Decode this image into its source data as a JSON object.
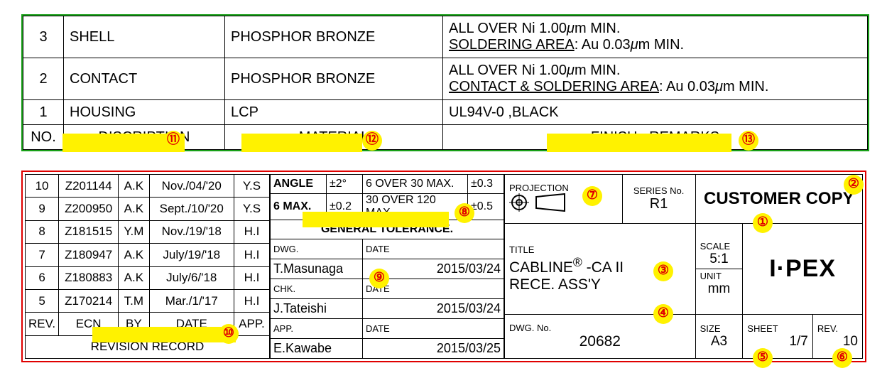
{
  "parts": {
    "headers": {
      "no": "NO.",
      "desc": "DISCRIPTION",
      "mat": "MATERIAL",
      "finish": "FINISH , REMARKS"
    },
    "rows": [
      {
        "no": "3",
        "desc": "SHELL",
        "mat": "PHOSPHOR BRONZE",
        "finish_l1a": "ALL OVER Ni 1.00",
        "finish_l1b": "μ",
        "finish_l1c": "m MIN.",
        "finish_l2a": "SOLDERING AREA",
        "finish_l2b": " : Au 0.03",
        "finish_l2c": "μ",
        "finish_l2d": "m MIN."
      },
      {
        "no": "2",
        "desc": "CONTACT",
        "mat": "PHOSPHOR BRONZE",
        "finish_l1a": "ALL OVER Ni 1.00",
        "finish_l1b": "μ",
        "finish_l1c": "m MIN.",
        "finish_l2a": "CONTACT & SOLDERING AREA",
        "finish_l2b": " : Au 0.03",
        "finish_l2c": "μ",
        "finish_l2d": "m MIN."
      },
      {
        "no": "1",
        "desc": "HOUSING",
        "mat": "LCP",
        "finish_plain": "UL94V-0 ,BLACK"
      }
    ]
  },
  "revisions": {
    "headers": {
      "rev": "REV.",
      "ecn": "ECN",
      "by": "BY",
      "date": "DATE",
      "app": "APP."
    },
    "title": "REVISION RECORD",
    "rows": [
      {
        "rev": "10",
        "ecn": "Z201144",
        "by": "A.K",
        "date": "Nov./04/'20",
        "app": "Y.S"
      },
      {
        "rev": "9",
        "ecn": "Z200950",
        "by": "A.K",
        "date": "Sept./10/'20",
        "app": "Y.S"
      },
      {
        "rev": "8",
        "ecn": "Z181515",
        "by": "Y.M",
        "date": "Nov./19/'18",
        "app": "H.I"
      },
      {
        "rev": "7",
        "ecn": "Z180947",
        "by": "A.K",
        "date": "July/19/'18",
        "app": "H.I"
      },
      {
        "rev": "6",
        "ecn": "Z180883",
        "by": "A.K",
        "date": "July/6/'18",
        "app": "H.I"
      },
      {
        "rev": "5",
        "ecn": "Z170214",
        "by": "T.M",
        "date": "Mar./1/'17",
        "app": "H.I"
      }
    ]
  },
  "tolerance": {
    "r1c1": "ANGLE",
    "r1c2": "±2°",
    "r1c3": "6 OVER 30 MAX.",
    "r1c4": "±0.3",
    "r2c1": "6 MAX.",
    "r2c2": "±0.2",
    "r2c3": "30 OVER 120 MAX.",
    "r2c4": "±0.5",
    "title": "GENERAL TOLERANCE."
  },
  "signatures": {
    "dwg_lbl": "DWG.",
    "dwg_name": "T.Masunaga",
    "dwg_date_lbl": "DATE",
    "dwg_date": "2015/03/24",
    "chk_lbl": "CHK.",
    "chk_name": "J.Tateishi",
    "chk_date_lbl": "DATE",
    "chk_date": "2015/03/24",
    "app_lbl": "APP.",
    "app_name": "E.Kawabe",
    "app_date_lbl": "DATE",
    "app_date": "2015/03/25"
  },
  "titleblock": {
    "projection_lbl": "PROJECTION",
    "series_lbl": "SERIES No.",
    "series": "R1",
    "copy": "CUSTOMER COPY",
    "title_lbl": "TITLE",
    "title_l1": "CABLINE",
    "title_reg": "®",
    "title_l1b": " -CA II",
    "title_l2": "RECE. ASS'Y",
    "scale_lbl": "SCALE",
    "scale": "5:1",
    "unit_lbl": "UNIT",
    "unit": "mm",
    "logo": "I·PEX",
    "dwgno_lbl": "DWG. No.",
    "dwgno": "20682",
    "size_lbl": "SIZE",
    "size": "A3",
    "sheet_lbl": "SHEET",
    "sheet": "1/7",
    "rev_lbl": "REV.",
    "rev": "10"
  },
  "badges": {
    "b1": "①",
    "b2": "②",
    "b3": "③",
    "b4": "④",
    "b5": "⑤",
    "b6": "⑥",
    "b7": "⑦",
    "b8": "⑧",
    "b9": "⑨",
    "b10": "⑩",
    "b11": "⑪",
    "b12": "⑫",
    "b13": "⑬"
  }
}
